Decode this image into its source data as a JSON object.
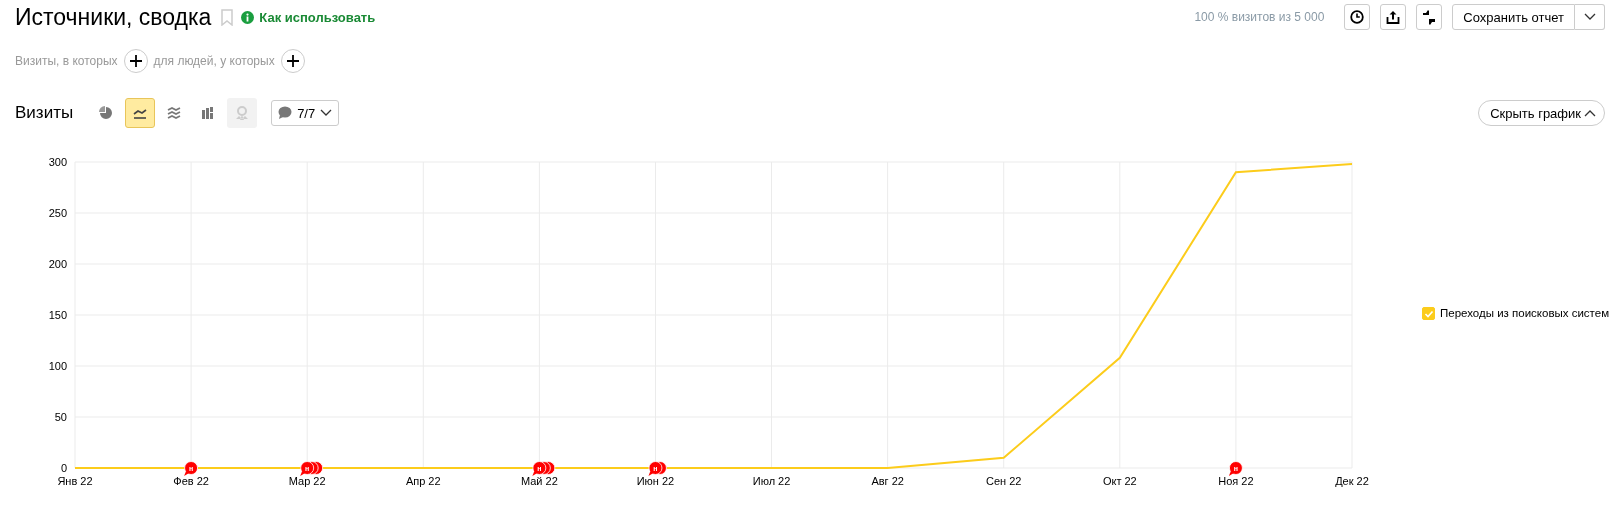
{
  "header": {
    "title": "Источники, сводка",
    "bookmarked": false,
    "help_link": "Как использовать",
    "sample_info": "100 % визитов из 5 000",
    "save_button": "Сохранить отчет"
  },
  "filters": {
    "visits_label": "Визиты, в которых",
    "people_label": "для людей, у которых"
  },
  "chart_toolbar": {
    "title": "Визиты",
    "views": [
      {
        "kind": "pie",
        "selected": false,
        "disabled": false
      },
      {
        "kind": "line",
        "selected": true,
        "disabled": false
      },
      {
        "kind": "area",
        "selected": false,
        "disabled": false
      },
      {
        "kind": "bar",
        "selected": false,
        "disabled": false
      },
      {
        "kind": "map",
        "selected": false,
        "disabled": true
      }
    ],
    "notes_count": "7/7",
    "hide_button": "Скрыть график"
  },
  "chart": {
    "chart_data": {
      "type": "line",
      "categories": [
        "Янв 22",
        "Фев 22",
        "Мар 22",
        "Апр 22",
        "Май 22",
        "Июн 22",
        "Июл 22",
        "Авг 22",
        "Сен 22",
        "Окт 22",
        "Ноя 22",
        "Дек 22"
      ],
      "series": [
        {
          "name": "Переходы из поисковых систем",
          "color": "#fccc1b",
          "values": [
            0,
            0,
            0,
            0,
            0,
            0,
            0,
            0,
            10,
            108,
            290,
            298
          ]
        }
      ],
      "ylim": [
        0,
        300
      ],
      "yticks": [
        0,
        50,
        100,
        150,
        200,
        250,
        300
      ],
      "grid": true
    },
    "note_slots": [
      {
        "has_notes": false
      },
      {
        "has_notes": true,
        "notes": [
          {
            "labeled": true,
            "text": "н"
          }
        ]
      },
      {
        "has_notes": true,
        "notes": [
          {
            "labeled": true,
            "text": "н"
          },
          {
            "labeled": false
          },
          {
            "labeled": false
          }
        ]
      },
      {
        "has_notes": false
      },
      {
        "has_notes": true,
        "notes": [
          {
            "labeled": true,
            "text": "н"
          },
          {
            "labeled": false
          },
          {
            "labeled": false
          }
        ]
      },
      {
        "has_notes": true,
        "notes": [
          {
            "labeled": true,
            "text": "н"
          },
          {
            "labeled": false
          }
        ]
      },
      {
        "has_notes": false
      },
      {
        "has_notes": false
      },
      {
        "has_notes": false
      },
      {
        "has_notes": false
      },
      {
        "has_notes": true,
        "notes": [
          {
            "labeled": true,
            "text": "н"
          }
        ]
      },
      {
        "has_notes": false
      }
    ],
    "legend": [
      {
        "checked": true
      }
    ]
  }
}
